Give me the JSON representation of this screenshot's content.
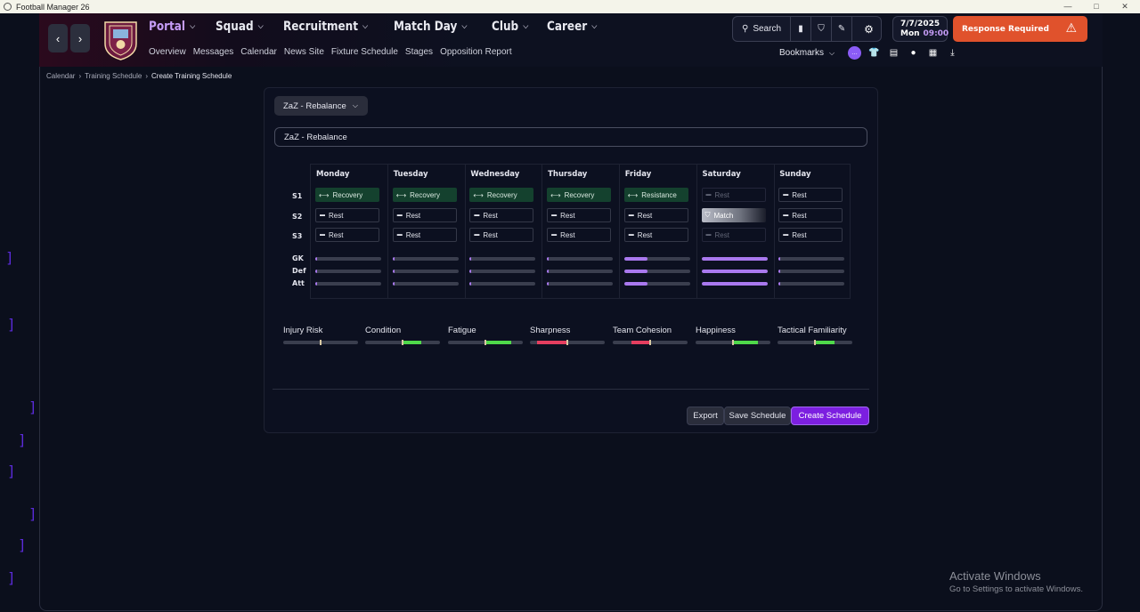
{
  "window": {
    "title": "Football Manager 26",
    "controls": [
      "—",
      "□",
      "✕"
    ]
  },
  "nav": {
    "menu": [
      {
        "label": "Portal",
        "active": true
      },
      {
        "label": "Squad",
        "active": false
      },
      {
        "label": "Recruitment",
        "active": false
      },
      {
        "label": "Match Day",
        "active": false
      },
      {
        "label": "Club",
        "active": false
      },
      {
        "label": "Career",
        "active": false
      }
    ],
    "submenu": [
      "Overview",
      "Messages",
      "Calendar",
      "News Site",
      "Fixture Schedule",
      "Stages",
      "Opposition Report"
    ],
    "search_label": "Search",
    "date": "7/7/2025",
    "day": "Mon",
    "time": "09:00",
    "response_label": "Response Required",
    "bookmarks_label": "Bookmarks"
  },
  "breadcrumb": [
    "Calendar",
    "Training Schedule",
    "Create Training Schedule"
  ],
  "schedule": {
    "selector_value": "ZaZ - Rebalance",
    "name_value": "ZaZ - Rebalance",
    "session_labels": [
      "S1",
      "S2",
      "S3"
    ],
    "unit_labels": [
      "GK",
      "Def",
      "Att"
    ],
    "days": [
      {
        "name": "Monday",
        "sessions": [
          {
            "label": "Recovery",
            "kind": "train"
          },
          {
            "label": "Rest",
            "kind": "rest"
          },
          {
            "label": "Rest",
            "kind": "rest"
          }
        ],
        "load": [
          0.02,
          0.02,
          0.02
        ]
      },
      {
        "name": "Tuesday",
        "sessions": [
          {
            "label": "Recovery",
            "kind": "train"
          },
          {
            "label": "Rest",
            "kind": "rest"
          },
          {
            "label": "Rest",
            "kind": "rest"
          }
        ],
        "load": [
          0.02,
          0.02,
          0.02
        ]
      },
      {
        "name": "Wednesday",
        "sessions": [
          {
            "label": "Recovery",
            "kind": "train"
          },
          {
            "label": "Rest",
            "kind": "rest"
          },
          {
            "label": "Rest",
            "kind": "rest"
          }
        ],
        "load": [
          0.02,
          0.02,
          0.02
        ]
      },
      {
        "name": "Thursday",
        "sessions": [
          {
            "label": "Recovery",
            "kind": "train"
          },
          {
            "label": "Rest",
            "kind": "rest"
          },
          {
            "label": "Rest",
            "kind": "rest"
          }
        ],
        "load": [
          0.02,
          0.02,
          0.02
        ]
      },
      {
        "name": "Friday",
        "sessions": [
          {
            "label": "Resistance",
            "kind": "train"
          },
          {
            "label": "Rest",
            "kind": "rest"
          },
          {
            "label": "Rest",
            "kind": "rest"
          }
        ],
        "load": [
          0.35,
          0.35,
          0.35
        ]
      },
      {
        "name": "Saturday",
        "sessions": [
          {
            "label": "Rest",
            "kind": "dim"
          },
          {
            "label": "Match",
            "kind": "match"
          },
          {
            "label": "Rest",
            "kind": "dim"
          }
        ],
        "load": [
          1.0,
          1.0,
          1.0
        ]
      },
      {
        "name": "Sunday",
        "sessions": [
          {
            "label": "Rest",
            "kind": "rest"
          },
          {
            "label": "Rest",
            "kind": "rest"
          },
          {
            "label": "Rest",
            "kind": "rest"
          }
        ],
        "load": [
          0.02,
          0.02,
          0.02
        ]
      }
    ]
  },
  "metrics": [
    {
      "label": "Injury Risk",
      "marker": 0.5,
      "segment": null,
      "color": "#3a3e4e"
    },
    {
      "label": "Condition",
      "marker": 0.5,
      "segment": [
        0.5,
        0.75
      ],
      "color": "#4fd94a"
    },
    {
      "label": "Fatigue",
      "marker": 0.5,
      "segment": [
        0.5,
        0.85
      ],
      "color": "#4fd94a"
    },
    {
      "label": "Sharpness",
      "marker": 0.5,
      "segment": [
        0.1,
        0.5
      ],
      "color": "#e53e5f"
    },
    {
      "label": "Team Cohesion",
      "marker": 0.5,
      "segment": [
        0.25,
        0.5
      ],
      "color": "#e53e5f"
    },
    {
      "label": "Happiness",
      "marker": 0.5,
      "segment": [
        0.5,
        0.83
      ],
      "color": "#4fd94a"
    },
    {
      "label": "Tactical Familiarity",
      "marker": 0.5,
      "segment": [
        0.5,
        0.76
      ],
      "color": "#4fd94a"
    }
  ],
  "actions": {
    "export": "Export",
    "save": "Save Schedule",
    "create": "Create Schedule"
  },
  "watermark": {
    "line1": "Activate Windows",
    "line2": "Go to Settings to activate Windows."
  },
  "colors": {
    "accent": "#7c1fe0",
    "nav_active": "#c59cf6",
    "alert": "#e0522c",
    "training": "#14412e",
    "load": "#a978ee"
  }
}
